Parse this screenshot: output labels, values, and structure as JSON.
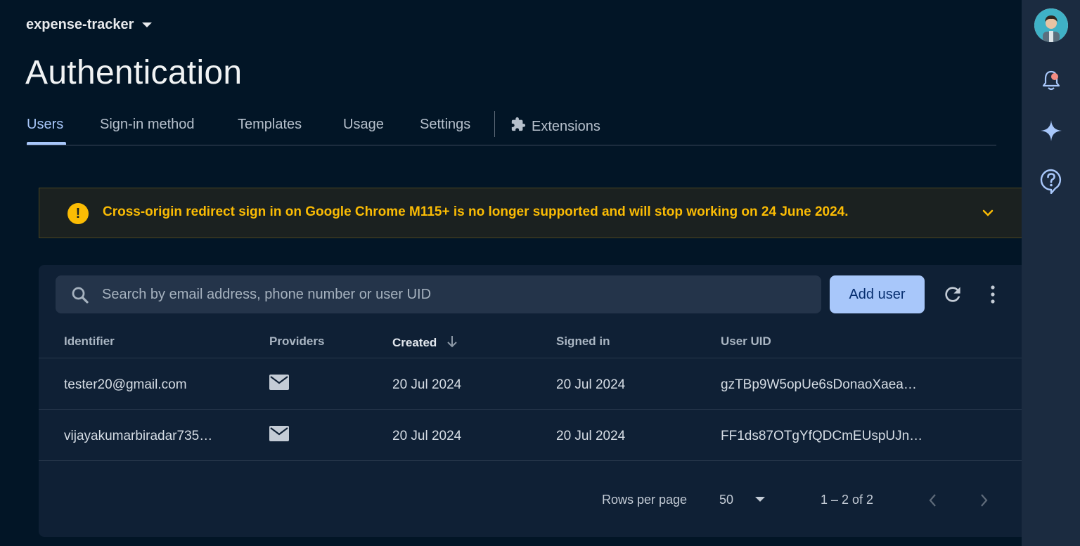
{
  "project": {
    "name": "expense-tracker"
  },
  "page": {
    "title": "Authentication"
  },
  "tabs": [
    {
      "label": "Users",
      "active": true
    },
    {
      "label": "Sign-in method"
    },
    {
      "label": "Templates"
    },
    {
      "label": "Usage"
    },
    {
      "label": "Settings"
    },
    {
      "label": "Extensions",
      "icon": "puzzle-icon"
    }
  ],
  "banner": {
    "icon": "warning-icon",
    "message": "Cross-origin redirect sign in on Google Chrome M115+ is no longer supported and will stop working on 24 June 2024.",
    "color": "#fbbc04"
  },
  "search": {
    "placeholder": "Search by email address, phone number or user UID"
  },
  "toolbar": {
    "add_user_label": "Add user"
  },
  "table": {
    "columns": [
      "Identifier",
      "Providers",
      "Created",
      "Signed in",
      "User UID"
    ],
    "sorted_column": "Created",
    "rows": [
      {
        "identifier": "tester20@gmail.com",
        "provider": "email-icon",
        "created": "20 Jul 2024",
        "signed_in": "20 Jul 2024",
        "uid": "gzTBp9W5opUe6sDonaoXaea…"
      },
      {
        "identifier": "vijayakumarbiradar735…",
        "provider": "email-icon",
        "created": "20 Jul 2024",
        "signed_in": "20 Jul 2024",
        "uid": "FF1ds87OTgYfQDCmEUspUJn…"
      }
    ]
  },
  "pagination": {
    "rows_per_page_label": "Rows per page",
    "rows_per_page": "50",
    "range": "1 – 2 of 2"
  },
  "colors": {
    "accent": "#a8c7fa",
    "background": "#021526",
    "warning": "#fbbc04"
  }
}
